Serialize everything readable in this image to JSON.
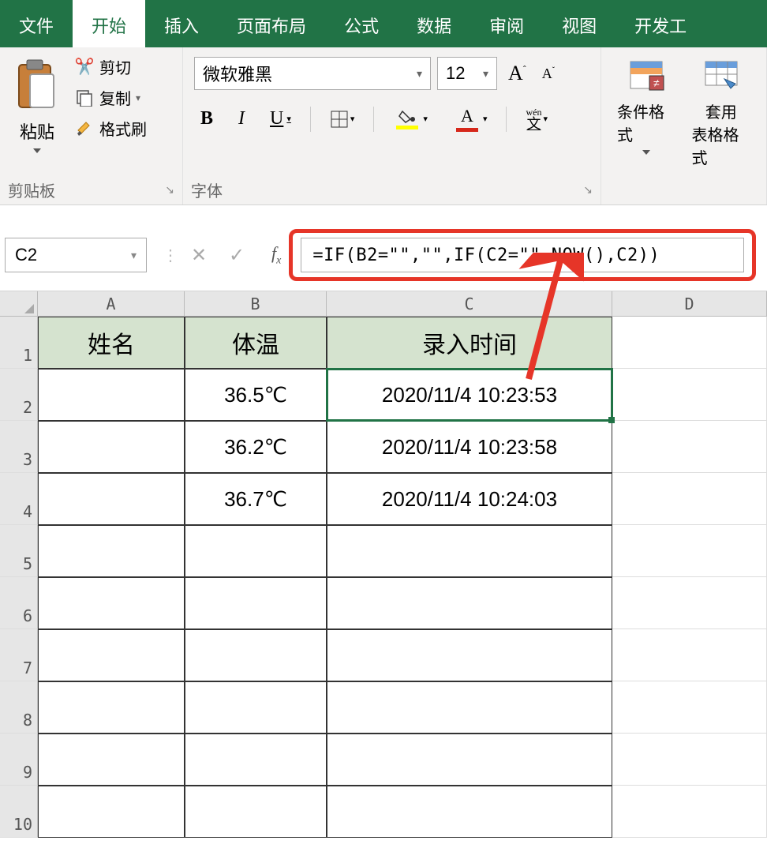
{
  "tabs": {
    "file": "文件",
    "home": "开始",
    "insert": "插入",
    "layout": "页面布局",
    "formula": "公式",
    "data": "数据",
    "review": "审阅",
    "view": "视图",
    "dev": "开发工"
  },
  "clipboard": {
    "paste": "粘贴",
    "cut": "剪切",
    "copy": "复制",
    "format_painter": "格式刷",
    "group_label": "剪贴板"
  },
  "font": {
    "name": "微软雅黑",
    "size": "12",
    "increase": "A",
    "decrease": "A",
    "bold": "B",
    "italic": "I",
    "underline": "U",
    "wen_top": "wén",
    "wen_bot": "文",
    "group_label": "字体"
  },
  "styles": {
    "cond_fmt": "条件格式",
    "table_fmt1": "套用",
    "table_fmt2": "表格格式"
  },
  "name_box": "C2",
  "formula": "=IF(B2=\"\",\"\",IF(C2=\"\",NOW(),C2))",
  "columns": [
    "A",
    "B",
    "C",
    "D"
  ],
  "rows": [
    "1",
    "2",
    "3",
    "4",
    "5",
    "6",
    "7",
    "8",
    "9",
    "10"
  ],
  "headers": {
    "A": "姓名",
    "B": "体温",
    "C": "录入时间"
  },
  "cells": {
    "B2": "36.5℃",
    "C2": "2020/11/4 10:23:53",
    "B3": "36.2℃",
    "C3": "2020/11/4 10:23:58",
    "B4": "36.7℃",
    "C4": "2020/11/4 10:24:03"
  }
}
